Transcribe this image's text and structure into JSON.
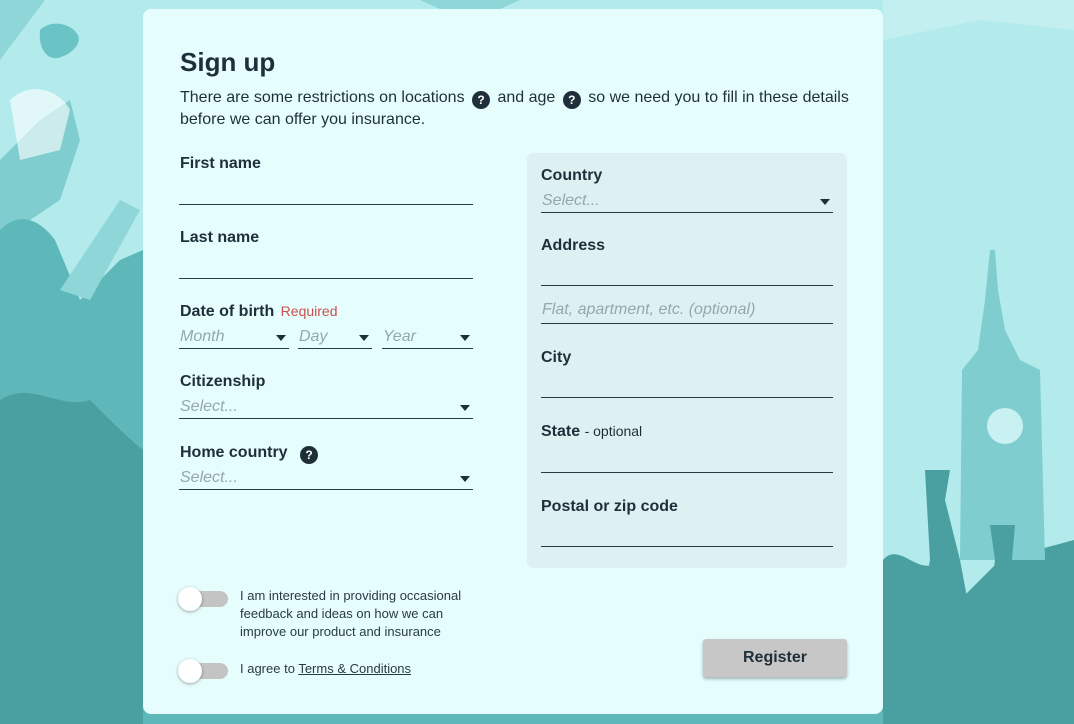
{
  "form": {
    "title": "Sign up",
    "intro_part1": "There are some restrictions on locations",
    "intro_part2": "and age",
    "intro_part3": "so we need you to fill in these details before we can offer you insurance.",
    "help_glyph": "?"
  },
  "left": {
    "first_name_label": "First name",
    "first_name_value": "",
    "last_name_label": "Last name",
    "last_name_value": "",
    "dob_label": "Date of birth",
    "dob_required": "Required",
    "dob_month": "Month",
    "dob_day": "Day",
    "dob_year": "Year",
    "citizenship_label": "Citizenship",
    "citizenship_value": "Select...",
    "home_country_label": "Home country",
    "home_country_value": "Select..."
  },
  "right": {
    "country_label": "Country",
    "country_value": "Select...",
    "address_label": "Address",
    "address_value": "",
    "address2_placeholder": "Flat, apartment, etc. (optional)",
    "city_label": "City",
    "city_value": "",
    "state_label": "State",
    "state_optional": "- optional",
    "state_value": "",
    "postal_label": "Postal or zip code",
    "postal_value": ""
  },
  "consents": {
    "feedback_text": "I am interested in providing occasional feedback and ideas on how we can improve our product and insurance",
    "feedback_on": false,
    "terms_prefix": "I agree to",
    "terms_link": "Terms & Conditions",
    "terms_on": false
  },
  "actions": {
    "register_label": "Register"
  },
  "colors": {
    "background": "#b3ebed",
    "card": "#e6fdfd",
    "panel": "#def1f2",
    "text": "#1f2f3a",
    "required": "#c9504c",
    "button": "#c7c7c7",
    "silhouette": "#5eb8b9"
  }
}
